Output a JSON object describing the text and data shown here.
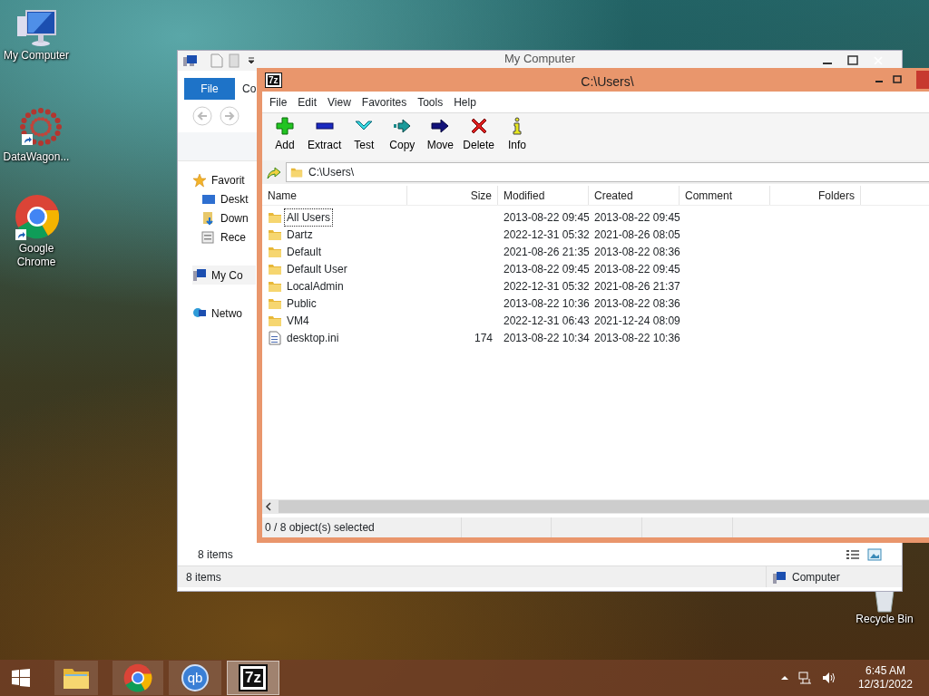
{
  "desktop_icons": [
    {
      "label": "My Computer",
      "kind": "computer"
    },
    {
      "label": "DataWagon...",
      "kind": "datawagon"
    },
    {
      "label": "Google Chrome",
      "kind": "chrome"
    },
    {
      "label": "Recycle Bin",
      "kind": "recycle"
    }
  ],
  "explorer": {
    "title": "My Computer",
    "ribbon_tabs": [
      "File",
      "Co"
    ],
    "nav_items": [
      {
        "label": "Favorit",
        "kind": "star"
      },
      {
        "label": "Deskt",
        "kind": "desktop"
      },
      {
        "label": "Down",
        "kind": "downloads"
      },
      {
        "label": "Rece",
        "kind": "recent"
      },
      {
        "label": "My Co",
        "kind": "computer"
      },
      {
        "label": "Netwo",
        "kind": "network"
      }
    ],
    "items_count": "8 items",
    "status": "8 items",
    "location": "Computer"
  },
  "archiver": {
    "logo": "7z",
    "title": "C:\\Users\\",
    "menu": [
      "File",
      "Edit",
      "View",
      "Favorites",
      "Tools",
      "Help"
    ],
    "toolbar": [
      {
        "label": "Add",
        "kind": "add"
      },
      {
        "label": "Extract",
        "kind": "extract"
      },
      {
        "label": "Test",
        "kind": "test"
      },
      {
        "label": "Copy",
        "kind": "copy"
      },
      {
        "label": "Move",
        "kind": "move"
      },
      {
        "label": "Delete",
        "kind": "delete"
      },
      {
        "label": "Info",
        "kind": "info"
      }
    ],
    "path": "C:\\Users\\",
    "columns": [
      "Name",
      "Size",
      "Modified",
      "Created",
      "Comment",
      "Folders"
    ],
    "rows": [
      {
        "name": "All Users",
        "kind": "folder",
        "modified": "2013-08-22 09:45",
        "created": "2013-08-22 09:45",
        "focused": true
      },
      {
        "name": "Dartz",
        "kind": "folder",
        "modified": "2022-12-31 05:32",
        "created": "2021-08-26 08:05",
        "focused": false
      },
      {
        "name": "Default",
        "kind": "folder",
        "modified": "2021-08-26 21:35",
        "created": "2013-08-22 08:36",
        "focused": false
      },
      {
        "name": "Default User",
        "kind": "folder",
        "modified": "2013-08-22 09:45",
        "created": "2013-08-22 09:45",
        "focused": false
      },
      {
        "name": "LocalAdmin",
        "kind": "folder",
        "modified": "2022-12-31 05:32",
        "created": "2021-08-26 21:37",
        "focused": false
      },
      {
        "name": "Public",
        "kind": "folder",
        "modified": "2013-08-22 10:36",
        "created": "2013-08-22 08:36",
        "focused": false
      },
      {
        "name": "VM4",
        "kind": "folder",
        "modified": "2022-12-31 06:43",
        "created": "2021-12-24 08:09",
        "focused": false
      },
      {
        "name": "desktop.ini",
        "kind": "file",
        "size": "174",
        "modified": "2013-08-22 10:34",
        "created": "2013-08-22 10:36",
        "focused": false
      }
    ],
    "status": "0 / 8 object(s) selected"
  },
  "taskbar": {
    "apps": [
      {
        "kind": "explorer",
        "selected": false
      },
      {
        "kind": "chrome",
        "selected": false
      },
      {
        "kind": "qbittorrent",
        "label": "qb",
        "selected": false
      },
      {
        "kind": "sevenzip",
        "label": "7z",
        "selected": true
      }
    ],
    "time": "6:45 AM",
    "date": "12/31/2022"
  }
}
